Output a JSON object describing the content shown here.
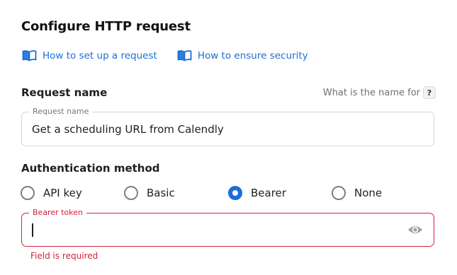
{
  "title": "Configure HTTP request",
  "links": [
    {
      "label": "How to set up a request",
      "icon": "book-icon"
    },
    {
      "label": "How to ensure security",
      "icon": "book-icon"
    }
  ],
  "request_name": {
    "section_label": "Request name",
    "help_text": "What is the name for",
    "help_badge": "?",
    "field_label": "Request name",
    "value": "Get a scheduling URL from Calendly"
  },
  "auth": {
    "section_label": "Authentication method",
    "options": [
      {
        "label": "API key",
        "selected": false
      },
      {
        "label": "Basic",
        "selected": false
      },
      {
        "label": "Bearer",
        "selected": true
      },
      {
        "label": "None",
        "selected": false
      }
    ],
    "token_field_label": "Bearer token",
    "token_value": "",
    "error": "Field is required"
  },
  "colors": {
    "accent": "#1a6fd6",
    "error": "#d0233b",
    "border": "#cfd6e0"
  }
}
